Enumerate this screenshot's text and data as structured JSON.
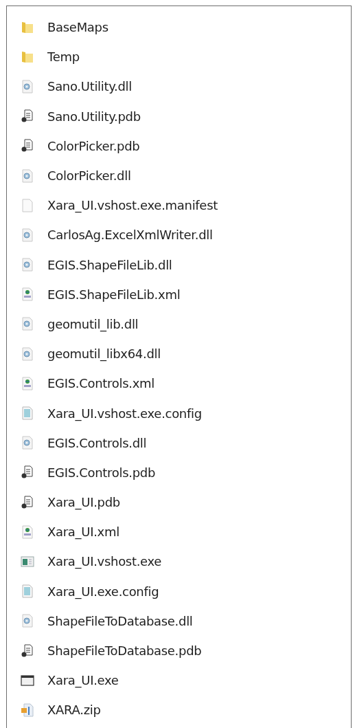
{
  "files": [
    {
      "name": "BaseMaps",
      "kind": "folder"
    },
    {
      "name": "Temp",
      "kind": "folder"
    },
    {
      "name": "Sano.Utility.dll",
      "kind": "dll"
    },
    {
      "name": "Sano.Utility.pdb",
      "kind": "pdb"
    },
    {
      "name": "ColorPicker.pdb",
      "kind": "pdb"
    },
    {
      "name": "ColorPicker.dll",
      "kind": "dll"
    },
    {
      "name": "Xara_UI.vshost.exe.manifest",
      "kind": "blank"
    },
    {
      "name": "CarlosAg.ExcelXmlWriter.dll",
      "kind": "dll"
    },
    {
      "name": "EGIS.ShapeFileLib.dll",
      "kind": "dll"
    },
    {
      "name": "EGIS.ShapeFileLib.xml",
      "kind": "xml"
    },
    {
      "name": "geomutil_lib.dll",
      "kind": "dll"
    },
    {
      "name": "geomutil_libx64.dll",
      "kind": "dll"
    },
    {
      "name": "EGIS.Controls.xml",
      "kind": "xml"
    },
    {
      "name": "Xara_UI.vshost.exe.config",
      "kind": "config"
    },
    {
      "name": "EGIS.Controls.dll",
      "kind": "dll"
    },
    {
      "name": "EGIS.Controls.pdb",
      "kind": "pdb"
    },
    {
      "name": "Xara_UI.pdb",
      "kind": "pdb"
    },
    {
      "name": "Xara_UI.xml",
      "kind": "xml"
    },
    {
      "name": "Xara_UI.vshost.exe",
      "kind": "app"
    },
    {
      "name": "Xara_UI.exe.config",
      "kind": "config"
    },
    {
      "name": "ShapeFileToDatabase.dll",
      "kind": "dll"
    },
    {
      "name": "ShapeFileToDatabase.pdb",
      "kind": "pdb"
    },
    {
      "name": "Xara_UI.exe",
      "kind": "exe"
    },
    {
      "name": "XARA.zip",
      "kind": "zip"
    }
  ]
}
